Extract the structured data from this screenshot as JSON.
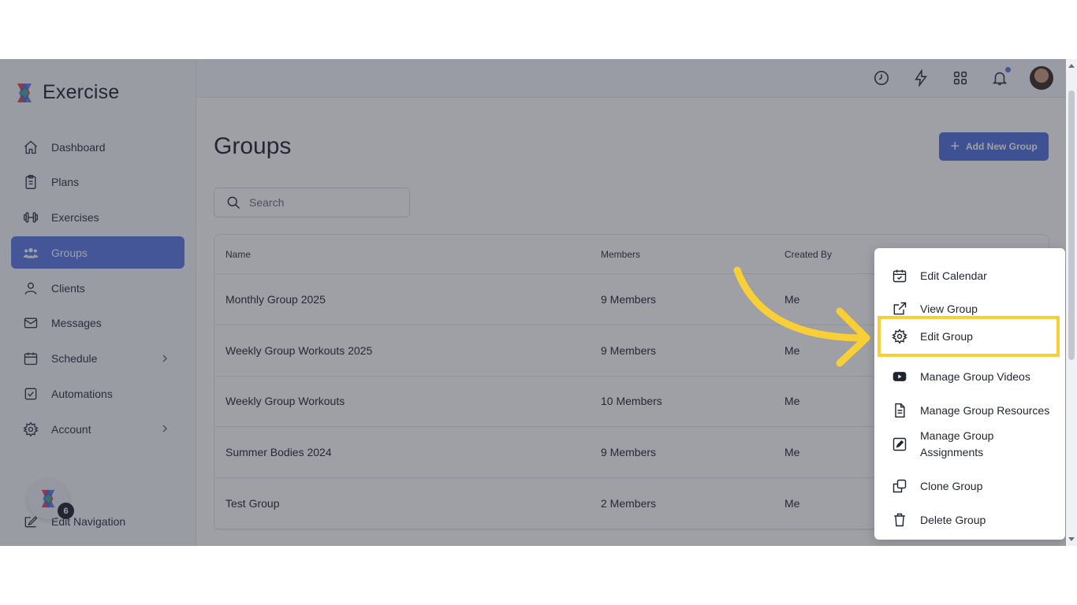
{
  "app": {
    "name": "Exercise"
  },
  "sidebar": {
    "items": [
      {
        "label": "Dashboard",
        "icon": "home-icon"
      },
      {
        "label": "Plans",
        "icon": "clipboard-icon"
      },
      {
        "label": "Exercises",
        "icon": "dumbbell-icon"
      },
      {
        "label": "Groups",
        "icon": "users-icon",
        "active": true
      },
      {
        "label": "Clients",
        "icon": "user-icon"
      },
      {
        "label": "Messages",
        "icon": "mail-icon"
      },
      {
        "label": "Schedule",
        "icon": "calendar-icon",
        "has_submenu": true
      },
      {
        "label": "Automations",
        "icon": "checkbox-icon"
      },
      {
        "label": "Account",
        "icon": "gear-icon",
        "has_submenu": true
      }
    ],
    "edit_navigation": "Edit Navigation",
    "fab_badge": "6"
  },
  "topbar": {
    "icons": [
      "clock-icon",
      "lightning-icon",
      "grid-icon",
      "bell-icon",
      "avatar"
    ]
  },
  "main": {
    "title": "Groups",
    "add_button": "Add New Group",
    "search_placeholder": "Search",
    "table": {
      "columns": [
        "Name",
        "Members",
        "Created By"
      ],
      "rows": [
        {
          "name": "Monthly Group 2025",
          "members": "9 Members",
          "created_by": "Me"
        },
        {
          "name": "Weekly Group Workouts 2025",
          "members": "9 Members",
          "created_by": "Me"
        },
        {
          "name": "Weekly Group Workouts",
          "members": "10 Members",
          "created_by": "Me"
        },
        {
          "name": "Summer Bodies 2024",
          "members": "9 Members",
          "created_by": "Me"
        },
        {
          "name": "Test Group",
          "members": "2 Members",
          "created_by": "Me"
        }
      ]
    }
  },
  "context_menu": {
    "items": [
      {
        "label": "Edit Calendar",
        "icon": "calendar-check-icon"
      },
      {
        "label": "View Group",
        "icon": "external-link-icon"
      },
      {
        "label": "Edit Group",
        "icon": "gear-icon",
        "highlighted": true
      },
      {
        "label": "Manage Group Videos",
        "icon": "youtube-icon"
      },
      {
        "label": "Manage Group Resources",
        "icon": "document-icon"
      },
      {
        "label": "Manage Group Assignments",
        "icon": "edit-square-icon"
      },
      {
        "label": "Clone Group",
        "icon": "copy-icon"
      },
      {
        "label": "Delete Group",
        "icon": "trash-icon"
      }
    ]
  },
  "colors": {
    "accent": "#5b79e6",
    "highlight": "#f8cf36"
  }
}
